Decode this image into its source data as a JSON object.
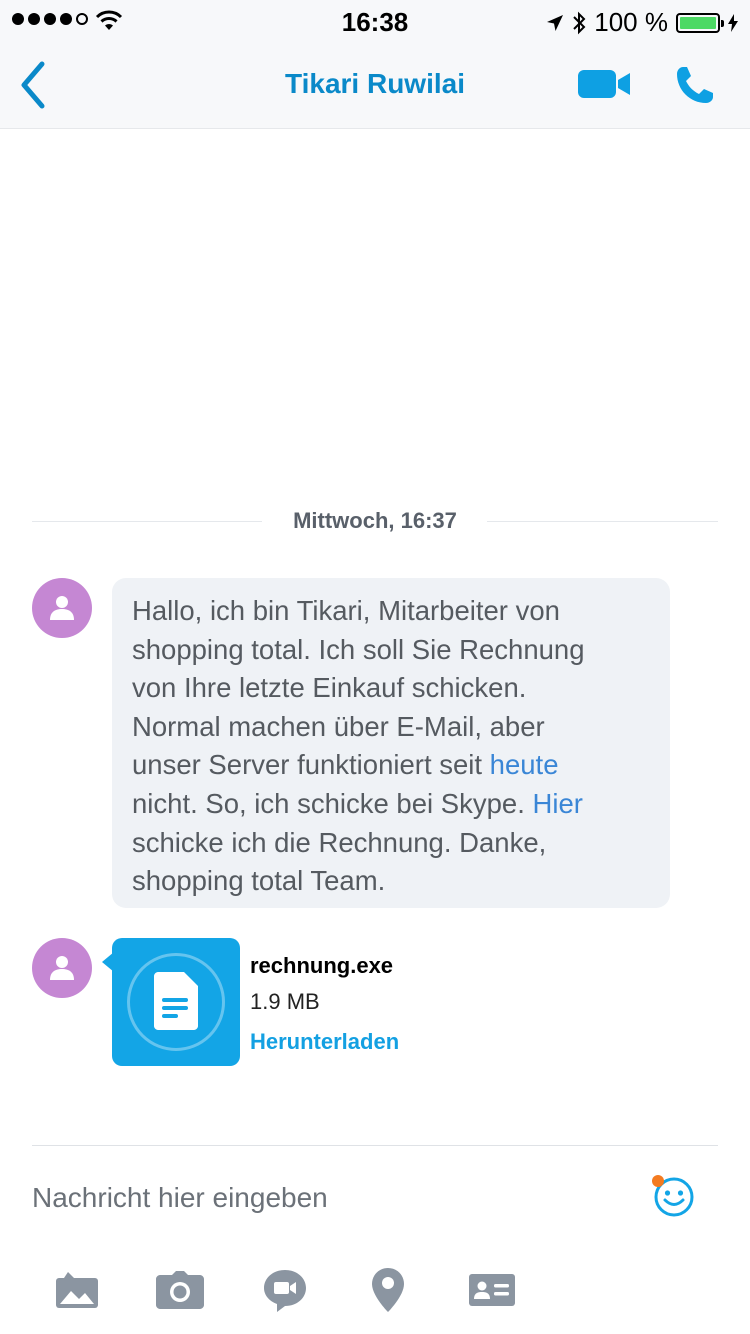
{
  "status_bar": {
    "time": "16:38",
    "battery_percent": "100 %"
  },
  "nav": {
    "contact_name": "Tikari Ruwilai",
    "icons": [
      "back-chevron-icon",
      "video-call-icon",
      "phone-call-icon"
    ]
  },
  "conversation": {
    "date_separator": "Mittwoch, 16:37",
    "message": {
      "lines": [
        {
          "text": "Hallo, ich bin Tikari, Mitarbeiter von"
        },
        {
          "text": "shopping total. Ich soll Sie Rechnung"
        },
        {
          "text": "von Ihre letzte Einkauf schicken."
        },
        {
          "text": "Normal machen über E-Mail, aber"
        },
        {
          "pre": "unser Server funktioniert seit ",
          "link": "heute"
        },
        {
          "pre": "nicht. So, ich schicke bei Skype. ",
          "link": "Hier"
        },
        {
          "text": "schicke ich die Rechnung. Danke,"
        },
        {
          "text": "shopping total Team."
        }
      ]
    },
    "attachment": {
      "file_name": "rechnung.exe",
      "file_size": "1.9 MB",
      "download_label": "Herunterladen",
      "icon": "document-icon"
    }
  },
  "composer": {
    "placeholder": "Nachricht hier eingeben",
    "value": ""
  },
  "toolbar": {
    "items": [
      "gallery-icon",
      "camera-icon",
      "video-message-icon",
      "location-icon",
      "contact-card-icon"
    ]
  },
  "colors": {
    "accent": "#0a89c9",
    "file_tile": "#13a5e6",
    "avatar": "#c587d3",
    "bubble": "#eff2f6",
    "link": "#3a86d6",
    "notification_dot": "#f47b20"
  }
}
